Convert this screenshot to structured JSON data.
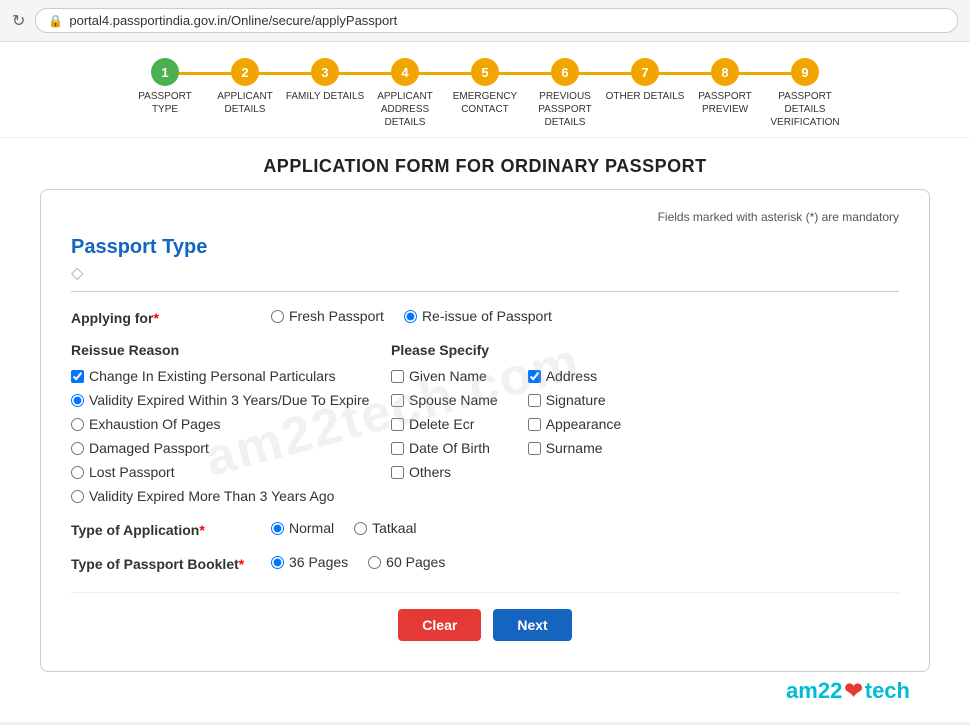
{
  "browser": {
    "refresh_icon": "↻",
    "lock_icon": "🔒",
    "url": "portal4.passportindia.gov.in/Online/secure/applyPassport"
  },
  "progress": {
    "steps": [
      {
        "number": "1",
        "label": "PASSPORT TYPE",
        "status": "green"
      },
      {
        "number": "2",
        "label": "APPLICANT DETAILS",
        "status": "orange"
      },
      {
        "number": "3",
        "label": "FAMILY DETAILS",
        "status": "orange"
      },
      {
        "number": "4",
        "label": "APPLICANT ADDRESS DETAILS",
        "status": "orange"
      },
      {
        "number": "5",
        "label": "EMERGENCY CONTACT",
        "status": "orange"
      },
      {
        "number": "6",
        "label": "PREVIOUS PASSPORT DETAILS",
        "status": "orange"
      },
      {
        "number": "7",
        "label": "OTHER DETAILS",
        "status": "orange"
      },
      {
        "number": "8",
        "label": "PASSPORT PREVIEW",
        "status": "orange"
      },
      {
        "number": "9",
        "label": "PASSPORT DETAILS VERIFICATION",
        "status": "orange"
      }
    ]
  },
  "page": {
    "title": "APPLICATION FORM FOR ORDINARY PASSPORT",
    "mandatory_note": "Fields marked with asterisk (*) are mandatory"
  },
  "form": {
    "section_title": "Passport Type",
    "applying_for_label": "Applying for",
    "applying_for_required": "*",
    "applying_for_options": [
      {
        "id": "fresh",
        "label": "Fresh Passport",
        "checked": false
      },
      {
        "id": "reissue",
        "label": "Re-issue of Passport",
        "checked": true
      }
    ],
    "reissue_reason": {
      "title": "Reissue Reason",
      "options": [
        {
          "id": "change",
          "label": "Change In Existing Personal Particulars",
          "checked": true,
          "type": "checkbox"
        },
        {
          "id": "validity3",
          "label": "Validity Expired Within 3 Years/Due To Expire",
          "checked": true,
          "type": "radio"
        },
        {
          "id": "exhaustion",
          "label": "Exhaustion Of Pages",
          "checked": false,
          "type": "radio"
        },
        {
          "id": "damaged",
          "label": "Damaged Passport",
          "checked": false,
          "type": "radio"
        },
        {
          "id": "lost",
          "label": "Lost Passport",
          "checked": false,
          "type": "radio"
        },
        {
          "id": "validity3more",
          "label": "Validity Expired More Than 3 Years Ago",
          "checked": false,
          "type": "radio"
        }
      ]
    },
    "please_specify": {
      "title": "Please Specify",
      "col1": [
        {
          "id": "given_name",
          "label": "Given Name",
          "checked": false
        },
        {
          "id": "spouse_name",
          "label": "Spouse Name",
          "checked": false
        },
        {
          "id": "delete_ecr",
          "label": "Delete Ecr",
          "checked": false
        },
        {
          "id": "date_of_birth",
          "label": "Date Of Birth",
          "checked": false
        },
        {
          "id": "others",
          "label": "Others",
          "checked": false
        }
      ],
      "col2": [
        {
          "id": "address",
          "label": "Address",
          "checked": true
        },
        {
          "id": "signature",
          "label": "Signature",
          "checked": false
        },
        {
          "id": "appearance",
          "label": "Appearance",
          "checked": false
        },
        {
          "id": "surname",
          "label": "Surname",
          "checked": false
        }
      ]
    },
    "type_of_application": {
      "label": "Type of Application",
      "required": "*",
      "options": [
        {
          "id": "normal",
          "label": "Normal",
          "checked": true
        },
        {
          "id": "tatkaal",
          "label": "Tatkaal",
          "checked": false
        }
      ]
    },
    "type_of_booklet": {
      "label": "Type of Passport Booklet",
      "required": "*",
      "options": [
        {
          "id": "36pages",
          "label": "36 Pages",
          "checked": true
        },
        {
          "id": "60pages",
          "label": "60 Pages",
          "checked": false
        }
      ]
    },
    "buttons": {
      "clear": "Clear",
      "next": "Next"
    }
  },
  "branding": {
    "text_left": "am22",
    "heart": "❤",
    "text_right": "tech"
  },
  "watermark": "am22tech.com"
}
